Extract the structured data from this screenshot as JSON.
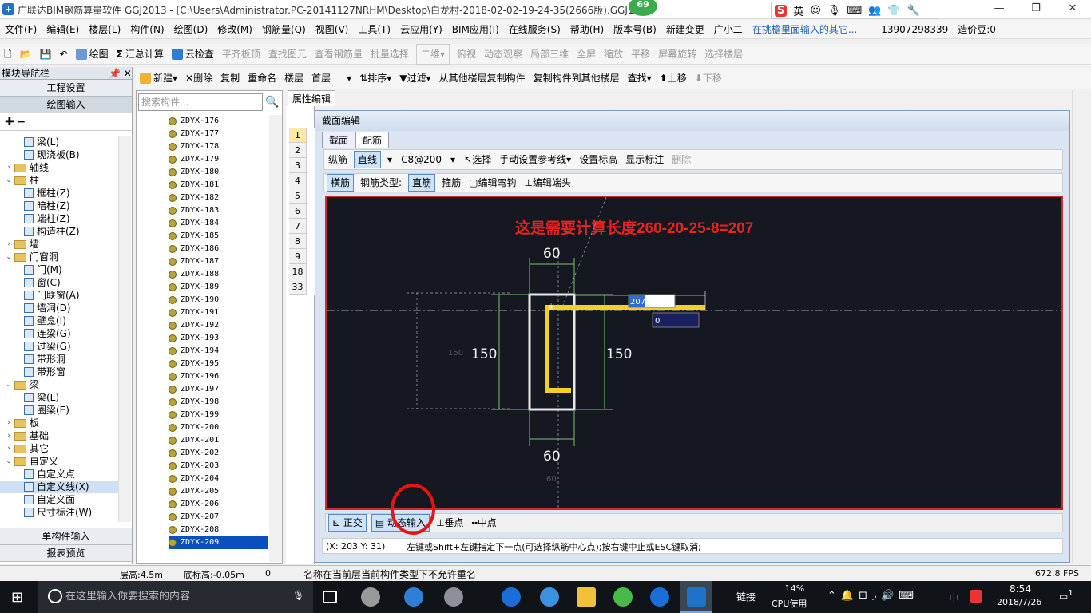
{
  "window": {
    "title": "广联达BIM钢筋算量软件 GGJ2013 - [C:\\Users\\Administrator.PC-20141127NRHM\\Desktop\\白龙村-2018-02-02-19-24-35(2666版).GGJ12]",
    "badge": "69",
    "ime": {
      "logo": "S",
      "lang": "英"
    }
  },
  "menu": {
    "items": [
      "文件(F)",
      "编辑(E)",
      "楼层(L)",
      "构件(N)",
      "绘图(D)",
      "修改(M)",
      "钢筋量(Q)",
      "视图(V)",
      "工具(T)",
      "云应用(Y)",
      "BIM应用(I)",
      "在线服务(S)",
      "帮助(H)",
      "版本号(B)",
      "新建变更",
      "广小二"
    ],
    "notice": "在挑檐里面输入的其它...",
    "phone": "13907298339",
    "price": "造价豆:0"
  },
  "toolbar1": {
    "items": [
      "绘图",
      "汇总计算",
      "云检查",
      "平齐板顶",
      "查找图元",
      "查看钢筋量",
      "批量选择",
      "二维",
      "俯视",
      "动态观察",
      "局部三维",
      "全屏",
      "缩放",
      "平移",
      "屏幕旋转",
      "选择楼层"
    ]
  },
  "toolbar2": {
    "new": "新建",
    "delete": "删除",
    "copy": "复制",
    "rename": "重命名",
    "floor_label": "楼层",
    "floor_value": "首层",
    "sort": "排序",
    "filter": "过滤",
    "copy_from": "从其他楼层复制构件",
    "copy_to": "复制构件到其他楼层",
    "find": "查找",
    "up": "上移",
    "down": "下移"
  },
  "nav": {
    "header": "模块导航栏",
    "buttons": [
      "工程设置",
      "绘图输入"
    ],
    "bottom_buttons": [
      "单构件输入",
      "报表预览"
    ],
    "tree": [
      {
        "indent": 2,
        "type": "leaf",
        "label": "梁(L)"
      },
      {
        "indent": 2,
        "type": "leaf",
        "label": "现浇板(B)"
      },
      {
        "indent": 0,
        "type": "folder",
        "exp": "›",
        "label": "轴线"
      },
      {
        "indent": 0,
        "type": "folder",
        "exp": "⌄",
        "label": "柱"
      },
      {
        "indent": 2,
        "type": "leaf",
        "label": "框柱(Z)"
      },
      {
        "indent": 2,
        "type": "leaf",
        "label": "暗柱(Z)"
      },
      {
        "indent": 2,
        "type": "leaf",
        "label": "端柱(Z)"
      },
      {
        "indent": 2,
        "type": "leaf",
        "label": "构造柱(Z)"
      },
      {
        "indent": 0,
        "type": "folder",
        "exp": "›",
        "label": "墙"
      },
      {
        "indent": 0,
        "type": "folder",
        "exp": "⌄",
        "label": "门窗洞"
      },
      {
        "indent": 2,
        "type": "leaf",
        "label": "门(M)"
      },
      {
        "indent": 2,
        "type": "leaf",
        "label": "窗(C)"
      },
      {
        "indent": 2,
        "type": "leaf",
        "label": "门联窗(A)"
      },
      {
        "indent": 2,
        "type": "leaf",
        "label": "墙洞(D)"
      },
      {
        "indent": 2,
        "type": "leaf",
        "label": "壁龛(I)"
      },
      {
        "indent": 2,
        "type": "leaf",
        "label": "连梁(G)"
      },
      {
        "indent": 2,
        "type": "leaf",
        "label": "过梁(G)"
      },
      {
        "indent": 2,
        "type": "leaf",
        "label": "带形洞"
      },
      {
        "indent": 2,
        "type": "leaf",
        "label": "带形窗"
      },
      {
        "indent": 0,
        "type": "folder",
        "exp": "⌄",
        "label": "梁"
      },
      {
        "indent": 2,
        "type": "leaf",
        "label": "梁(L)"
      },
      {
        "indent": 2,
        "type": "leaf",
        "label": "圈梁(E)"
      },
      {
        "indent": 0,
        "type": "folder",
        "exp": "›",
        "label": "板"
      },
      {
        "indent": 0,
        "type": "folder",
        "exp": "›",
        "label": "基础"
      },
      {
        "indent": 0,
        "type": "folder",
        "exp": "›",
        "label": "其它"
      },
      {
        "indent": 0,
        "type": "folder",
        "exp": "⌄",
        "label": "自定义"
      },
      {
        "indent": 2,
        "type": "leaf",
        "label": "自定义点"
      },
      {
        "indent": 2,
        "type": "leaf",
        "label": "自定义线(X)",
        "selected": true
      },
      {
        "indent": 2,
        "type": "leaf",
        "label": "自定义面"
      },
      {
        "indent": 2,
        "type": "leaf",
        "label": "尺寸标注(W)"
      }
    ]
  },
  "components": {
    "search_placeholder": "搜索构件...",
    "items": [
      "ZDYX-176",
      "ZDYX-177",
      "ZDYX-178",
      "ZDYX-179",
      "ZDYX-180",
      "ZDYX-181",
      "ZDYX-182",
      "ZDYX-183",
      "ZDYX-184",
      "ZDYX-185",
      "ZDYX-186",
      "ZDYX-187",
      "ZDYX-188",
      "ZDYX-189",
      "ZDYX-190",
      "ZDYX-191",
      "ZDYX-192",
      "ZDYX-193",
      "ZDYX-194",
      "ZDYX-195",
      "ZDYX-196",
      "ZDYX-197",
      "ZDYX-198",
      "ZDYX-199",
      "ZDYX-200",
      "ZDYX-201",
      "ZDYX-202",
      "ZDYX-203",
      "ZDYX-204",
      "ZDYX-205",
      "ZDYX-206",
      "ZDYX-207",
      "ZDYX-208",
      "ZDYX-209"
    ],
    "selected": "ZDYX-209"
  },
  "properties": {
    "tab": "属性编辑",
    "rows": [
      "1",
      "2",
      "3",
      "4",
      "5",
      "6",
      "7",
      "8",
      "9",
      "18",
      "33"
    ]
  },
  "dialog": {
    "title": "截面编辑",
    "tabs": [
      "截面",
      "配筋"
    ],
    "tb1": {
      "zongjin": "纵筋",
      "line": "直线",
      "spec": "C8@200",
      "select": "选择",
      "manual": "手动设置参考线",
      "set_elev": "设置标高",
      "show_dim": "显示标注",
      "delete": "删除"
    },
    "tb2": {
      "hengjin": "横筋",
      "type_label": "钢筋类型:",
      "zhijin": "直筋",
      "gujin": "箍筋",
      "edit_hook": "编辑弯钩",
      "edit_end": "编辑端头"
    },
    "bottom": {
      "ortho": "正交",
      "dyn": "动态输入",
      "perp": "垂点",
      "mid": "中点"
    },
    "status": {
      "coord": "(X: 203 Y: 31)",
      "msg": "左键或Shift+左键指定下一点(可选择纵筋中心点);按右键中止或ESC键取消;"
    }
  },
  "canvas": {
    "annotation": "这是需要计算长度260-20-25-8=207",
    "dim_top": "60",
    "dim_bottom": "60",
    "dim_left": "150",
    "dim_right": "150",
    "dim_left_faint": "150",
    "dim_bottom_faint": "60",
    "input_value": "207",
    "input_second": "0"
  },
  "statusbar": {
    "floor_h": "层高:4.5m",
    "base_h": "底标高:-0.05m",
    "zero": "0",
    "msg": "名称在当前层当前构件类型下不允许重名",
    "fps": "672.8 FPS"
  },
  "taskbar": {
    "search": "在这里输入你要搜索的内容",
    "link": "链接",
    "cpu_pct": "14%",
    "cpu_label": "CPU使用",
    "lang": "中",
    "time": "8:54",
    "date": "2018/7/26",
    "notif": "1"
  }
}
